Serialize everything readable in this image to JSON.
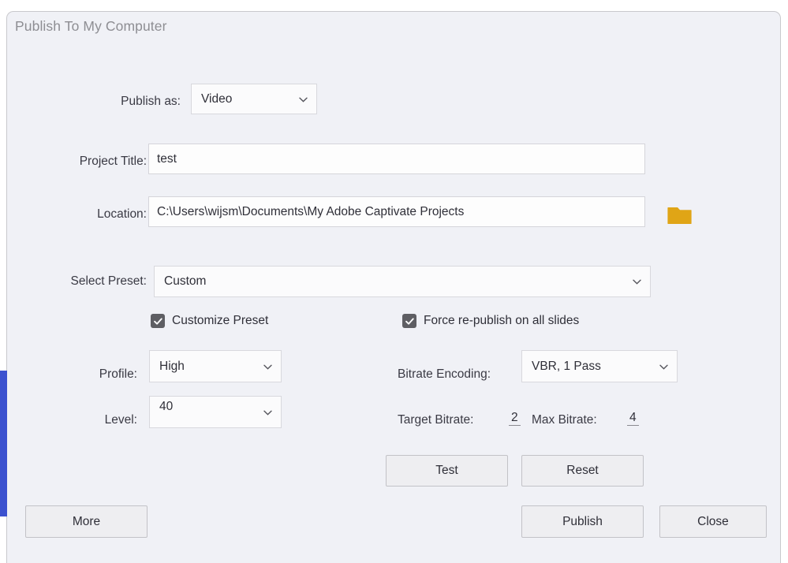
{
  "dialog": {
    "title": "Publish To My Computer",
    "accent_color": "#3b51cf",
    "background": "#f0f1f6"
  },
  "fields": {
    "publish_as": {
      "label": "Publish as:",
      "value": "Video",
      "icon": "chevron-down-icon"
    },
    "project_title": {
      "label": "Project Title:",
      "value": "test",
      "placeholder": "Project Title"
    },
    "location": {
      "label": "Location:",
      "value": "C:\\Users\\wijsm\\Documents\\My Adobe Captivate Projects",
      "placeholder": "Location",
      "browse_icon": "folder-icon",
      "browse_icon_color": "#e0a516"
    },
    "select_preset": {
      "label": "Select Preset:",
      "value": "Custom",
      "icon": "chevron-down-icon"
    },
    "customize_preset": {
      "label": "Customize Preset",
      "checked": true,
      "icon": "checkmark-icon"
    },
    "force_republish": {
      "label": "Force re-publish on all slides",
      "checked": true,
      "icon": "checkmark-icon"
    },
    "profile": {
      "label": "Profile:",
      "value": "High",
      "icon": "chevron-down-icon"
    },
    "level": {
      "label": "Level:",
      "value": "40",
      "icon": "chevron-down-icon"
    },
    "bitrate_encoding": {
      "label": "Bitrate Encoding:",
      "value": "VBR, 1 Pass",
      "icon": "chevron-down-icon"
    },
    "target_bitrate": {
      "label": "Target Bitrate:",
      "value": "2"
    },
    "max_bitrate": {
      "label": "Max Bitrate:",
      "value": "4"
    }
  },
  "buttons": {
    "test": "Test",
    "reset": "Reset",
    "more": "More",
    "publish": "Publish",
    "close": "Close"
  }
}
